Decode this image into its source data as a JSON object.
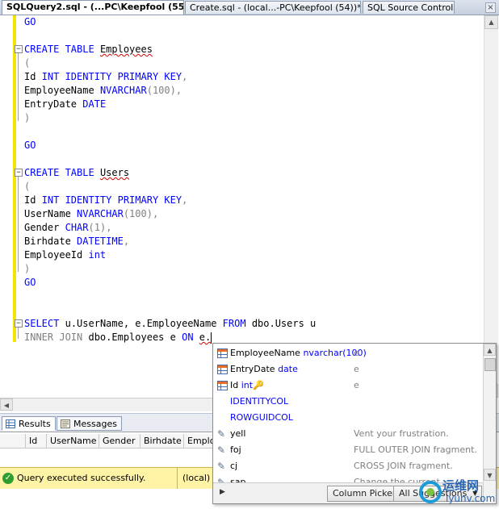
{
  "tabs": [
    {
      "label": "SQLQuery2.sql - (...PC\\Keepfool (55))*",
      "active": true
    },
    {
      "label": "Create.sql - (local...-PC\\Keepfool (54))*",
      "active": false
    },
    {
      "label": "SQL Source Control",
      "active": false
    }
  ],
  "tab_close": "×",
  "code": {
    "go1": "GO",
    "create_kw": "CREATE TABLE",
    "employees": "Employees",
    "open_paren": "(",
    "id": "Id",
    "int_identity_pk": "INT IDENTITY PRIMARY KEY",
    "comma": ",",
    "employee_name": "EmployeeName",
    "nvarchar": "NVARCHAR",
    "nvarchar_len100": "(100)",
    "entry_date": "EntryDate",
    "date": "DATE",
    "close_paren": ")",
    "go2": "GO",
    "users": "Users",
    "user_name": "UserName",
    "gender": "Gender",
    "char": "CHAR",
    "char_len": "(1)",
    "birhdate": "Birhdate",
    "datetime": "DATETIME",
    "employee_id": "EmployeeId",
    "int_lower": "int",
    "go3": "GO",
    "select_kw": "SELECT",
    "select_cols": "u.UserName, e.EmployeeName",
    "from_kw": "FROM",
    "from_table": "dbo.Users u",
    "inner_join": "INNER JOIN",
    "join_table": "dbo.Employees e",
    "on_kw": "ON",
    "typed": "e."
  },
  "results_tabs": [
    {
      "label": "Results",
      "active": true
    },
    {
      "label": "Messages",
      "active": false
    }
  ],
  "grid_headers": [
    "Id",
    "UserName",
    "Gender",
    "Birhdate",
    "Employ"
  ],
  "status": {
    "message": "Query executed successfully.",
    "server": "(local)"
  },
  "popup": {
    "items": [
      {
        "name": "EmployeeName",
        "type": "nvarchar(100)",
        "desc": "e",
        "icon": "column-icon"
      },
      {
        "name": "EntryDate",
        "type": "date",
        "desc": "e",
        "icon": "column-icon"
      },
      {
        "name": "Id",
        "type": "int",
        "desc": "e",
        "icon": "column-icon"
      },
      {
        "name": "IDENTITYCOL",
        "type": "",
        "desc": "",
        "icon": ""
      },
      {
        "name": "ROWGUIDCOL",
        "type": "",
        "desc": "",
        "icon": ""
      },
      {
        "name": "yell",
        "type": "",
        "desc": "Vent your frustration.",
        "icon": "snippet-icon"
      },
      {
        "name": "foj",
        "type": "",
        "desc": "FULL OUTER JOIN fragment.",
        "icon": "snippet-icon"
      },
      {
        "name": "cj",
        "type": "",
        "desc": "CROSS JOIN fragment.",
        "icon": "snippet-icon"
      },
      {
        "name": "sap",
        "type": "",
        "desc": "Change the current",
        "icon": "snippet-icon"
      }
    ],
    "column_picker": "Column Picker",
    "all_suggestions": "All Suggestions"
  },
  "watermark": {
    "cn": "运维网",
    "en": "iyunv.com"
  },
  "colors": {
    "keyword": "#0000ff",
    "comment_gray": "#808080",
    "changebar": "#f2e600",
    "status_bg": "#fff3a5"
  }
}
